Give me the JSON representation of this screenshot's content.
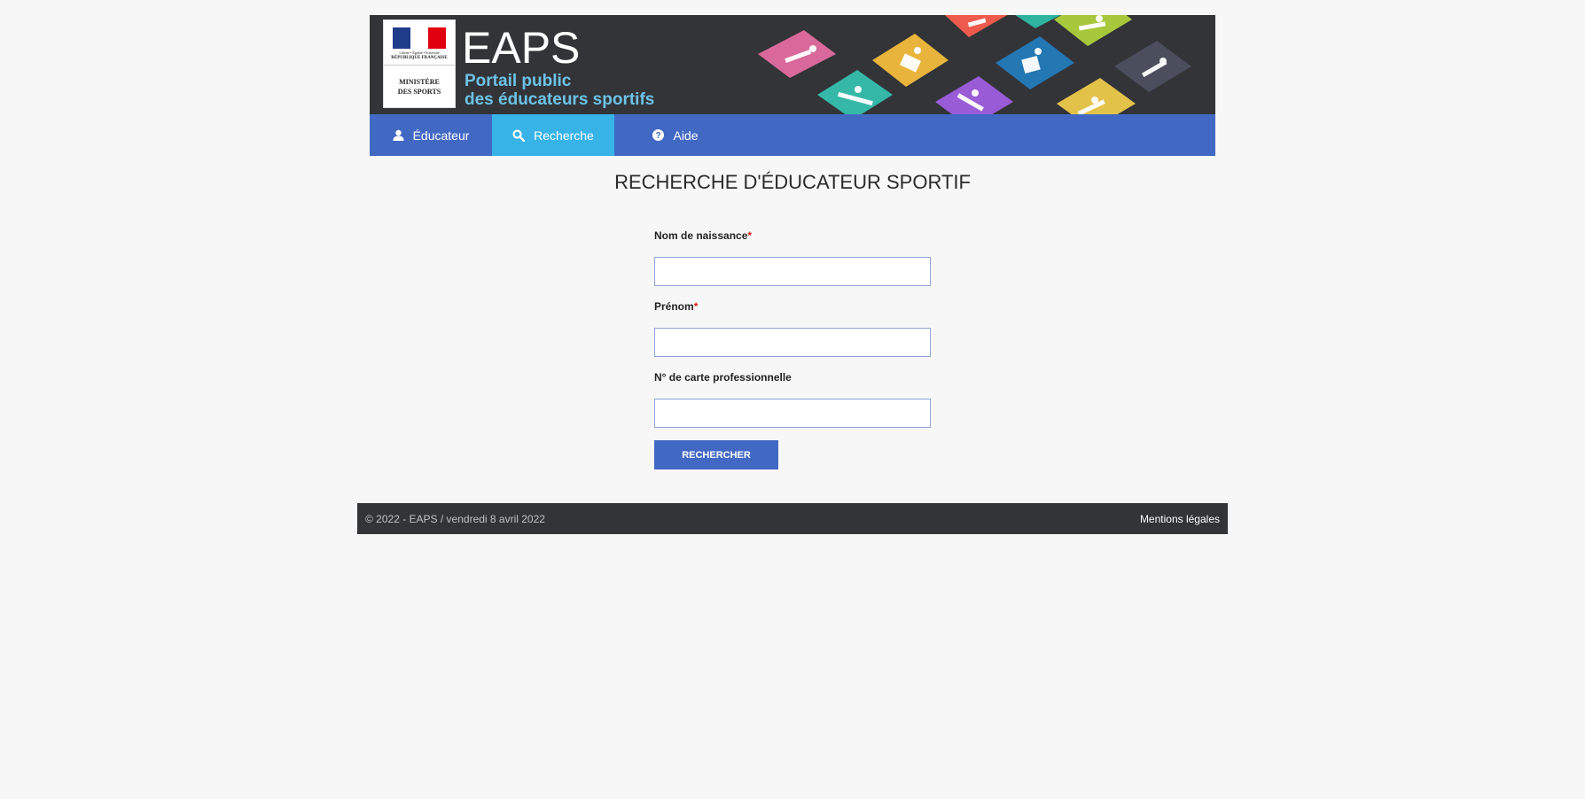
{
  "header": {
    "logo_motto": "Liberté • Égalité • Fraternité",
    "logo_republic": "RÉPUBLIQUE FRANÇAISE",
    "ministry_line1": "MINISTÈRE",
    "ministry_line2": "DES SPORTS",
    "app_title": "EAPS",
    "subtitle_line1": "Portail public",
    "subtitle_line2": "des éducateurs sportifs"
  },
  "nav": {
    "items": [
      {
        "label": "Éducateur",
        "icon": "user-icon",
        "active": false
      },
      {
        "label": "Recherche",
        "icon": "search-icon",
        "active": true
      },
      {
        "label": "Aide",
        "icon": "help-icon",
        "active": false
      }
    ]
  },
  "main": {
    "title": "RECHERCHE D'ÉDUCATEUR SPORTIF",
    "fields": [
      {
        "label": "Nom de naissance",
        "required": "*",
        "value": ""
      },
      {
        "label": "Prénom",
        "required": "*",
        "value": ""
      },
      {
        "label": "N° de carte professionnelle",
        "required": "",
        "value": ""
      }
    ],
    "search_button": "RECHERCHER"
  },
  "footer": {
    "copyright": "© 2022 - EAPS / vendredi 8 avril 2022",
    "legal_link": "Mentions légales"
  },
  "colors": {
    "nav_bg": "#4169c4",
    "nav_active": "#37b3e8",
    "header_bg": "#333438",
    "required_star": "#d9231f"
  }
}
